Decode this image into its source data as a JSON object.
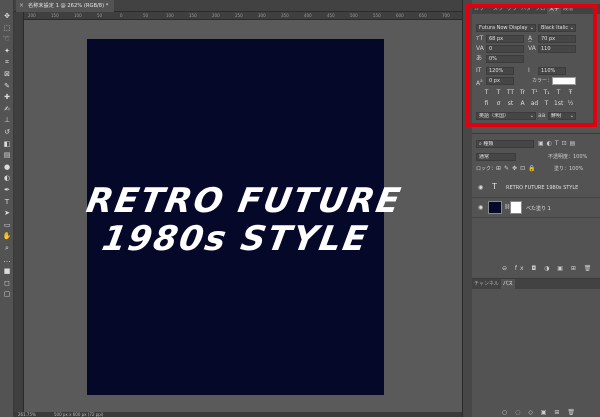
{
  "document": {
    "tab_title": "名称未設定 1 @ 262% (RGB/8) *",
    "close_glyph": "×",
    "ruler_ticks": [
      "200",
      "150",
      "100",
      "50",
      "0",
      "50",
      "100",
      "150",
      "200",
      "250",
      "300",
      "350",
      "400",
      "450",
      "500",
      "550",
      "600",
      "650",
      "700"
    ],
    "status_zoom": "261.75%",
    "status_size": "500 px x 600 px (72 ppi)"
  },
  "artwork": {
    "line1": "RETRO FUTURE",
    "line2": "1980s STYLE",
    "background_color": "#06082a",
    "text_color": "#ffffff"
  },
  "toolbar": {
    "tools": [
      {
        "icon": "move-icon",
        "glyph": "✥"
      },
      {
        "icon": "marquee-icon",
        "glyph": "⬚"
      },
      {
        "icon": "lasso-icon",
        "glyph": "➰"
      },
      {
        "icon": "magic-wand-icon",
        "glyph": "✦"
      },
      {
        "icon": "crop-icon",
        "glyph": "⌗"
      },
      {
        "icon": "frame-icon",
        "glyph": "⊠"
      },
      {
        "icon": "eyedropper-icon",
        "glyph": "✎"
      },
      {
        "icon": "healing-icon",
        "glyph": "✚"
      },
      {
        "icon": "brush-icon",
        "glyph": "✍"
      },
      {
        "icon": "stamp-icon",
        "glyph": "⊥"
      },
      {
        "icon": "history-brush-icon",
        "glyph": "↺"
      },
      {
        "icon": "eraser-icon",
        "glyph": "◧"
      },
      {
        "icon": "gradient-icon",
        "glyph": "▤"
      },
      {
        "icon": "blur-icon",
        "glyph": "●"
      },
      {
        "icon": "dodge-icon",
        "glyph": "◐"
      },
      {
        "icon": "pen-icon",
        "glyph": "✒"
      },
      {
        "icon": "type-icon",
        "glyph": "T"
      },
      {
        "icon": "path-select-icon",
        "glyph": "➤"
      },
      {
        "icon": "shape-icon",
        "glyph": "▭"
      },
      {
        "icon": "hand-icon",
        "glyph": "✋"
      },
      {
        "icon": "zoom-icon",
        "glyph": "⌕"
      },
      {
        "icon": "more-icon",
        "glyph": "…"
      },
      {
        "icon": "color-swatch-icon",
        "glyph": "■"
      },
      {
        "icon": "quick-mask-icon",
        "glyph": "◻"
      },
      {
        "icon": "screen-mode-icon",
        "glyph": "▢"
      }
    ]
  },
  "top_tabs": [
    "カラー",
    "スウ",
    "グラ",
    "パタ",
    "プロ",
    "文字",
    "段落"
  ],
  "character": {
    "font_family": "Futura Now Display",
    "font_style": "Black Italic",
    "font_size": "68 px",
    "leading": "70 px",
    "kerning": "0",
    "tracking": "110",
    "tsume": "0%",
    "vertical_scale": "120%",
    "horizontal_scale": "110%",
    "baseline_shift": "0 px",
    "color_label": "カラー：",
    "color_value": "#ffffff",
    "style_glyphs": [
      "T",
      "T",
      "TT",
      "Tr",
      "T¹",
      "T₁",
      "T",
      "Ŧ"
    ],
    "opentype_glyphs": [
      "fi",
      "ơ",
      "st",
      "A",
      "ad",
      "T",
      "1st",
      "½"
    ],
    "language": "英語（米国）",
    "aa_icon": "aa",
    "anti_alias": "鮮明"
  },
  "layers": {
    "search_kind": "種類",
    "blend_mode": "通常",
    "opacity": "不透明度：100%",
    "lock_label": "ロック：",
    "fill": "塗り：100%",
    "items": [
      {
        "name": "RETRO FUTURE 1980s STYLE",
        "type": "text",
        "thumb_glyph": "T"
      },
      {
        "name": "べた塗り 1",
        "type": "fill"
      }
    ],
    "bottom_icons": "⊖ fx ◘ ◑ ▣ ⊞ 🗑"
  },
  "channels": {
    "tabs": [
      "チャンネル",
      "パス"
    ],
    "bottom_icons": "○ ◌ ◇ ▣ ⊞ 🗑"
  }
}
